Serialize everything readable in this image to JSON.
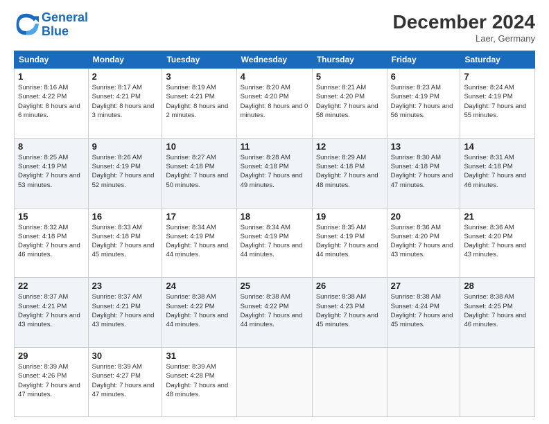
{
  "header": {
    "logo_line1": "General",
    "logo_line2": "Blue",
    "month_year": "December 2024",
    "location": "Laer, Germany"
  },
  "columns": [
    "Sunday",
    "Monday",
    "Tuesday",
    "Wednesday",
    "Thursday",
    "Friday",
    "Saturday"
  ],
  "weeks": [
    [
      {
        "day": "1",
        "sunrise": "8:16 AM",
        "sunset": "4:22 PM",
        "daylight": "8 hours and 6 minutes."
      },
      {
        "day": "2",
        "sunrise": "8:17 AM",
        "sunset": "4:21 PM",
        "daylight": "8 hours and 3 minutes."
      },
      {
        "day": "3",
        "sunrise": "8:19 AM",
        "sunset": "4:21 PM",
        "daylight": "8 hours and 2 minutes."
      },
      {
        "day": "4",
        "sunrise": "8:20 AM",
        "sunset": "4:20 PM",
        "daylight": "8 hours and 0 minutes."
      },
      {
        "day": "5",
        "sunrise": "8:21 AM",
        "sunset": "4:20 PM",
        "daylight": "7 hours and 58 minutes."
      },
      {
        "day": "6",
        "sunrise": "8:23 AM",
        "sunset": "4:19 PM",
        "daylight": "7 hours and 56 minutes."
      },
      {
        "day": "7",
        "sunrise": "8:24 AM",
        "sunset": "4:19 PM",
        "daylight": "7 hours and 55 minutes."
      }
    ],
    [
      {
        "day": "8",
        "sunrise": "8:25 AM",
        "sunset": "4:19 PM",
        "daylight": "7 hours and 53 minutes."
      },
      {
        "day": "9",
        "sunrise": "8:26 AM",
        "sunset": "4:19 PM",
        "daylight": "7 hours and 52 minutes."
      },
      {
        "day": "10",
        "sunrise": "8:27 AM",
        "sunset": "4:18 PM",
        "daylight": "7 hours and 50 minutes."
      },
      {
        "day": "11",
        "sunrise": "8:28 AM",
        "sunset": "4:18 PM",
        "daylight": "7 hours and 49 minutes."
      },
      {
        "day": "12",
        "sunrise": "8:29 AM",
        "sunset": "4:18 PM",
        "daylight": "7 hours and 48 minutes."
      },
      {
        "day": "13",
        "sunrise": "8:30 AM",
        "sunset": "4:18 PM",
        "daylight": "7 hours and 47 minutes."
      },
      {
        "day": "14",
        "sunrise": "8:31 AM",
        "sunset": "4:18 PM",
        "daylight": "7 hours and 46 minutes."
      }
    ],
    [
      {
        "day": "15",
        "sunrise": "8:32 AM",
        "sunset": "4:18 PM",
        "daylight": "7 hours and 46 minutes."
      },
      {
        "day": "16",
        "sunrise": "8:33 AM",
        "sunset": "4:18 PM",
        "daylight": "7 hours and 45 minutes."
      },
      {
        "day": "17",
        "sunrise": "8:34 AM",
        "sunset": "4:19 PM",
        "daylight": "7 hours and 44 minutes."
      },
      {
        "day": "18",
        "sunrise": "8:34 AM",
        "sunset": "4:19 PM",
        "daylight": "7 hours and 44 minutes."
      },
      {
        "day": "19",
        "sunrise": "8:35 AM",
        "sunset": "4:19 PM",
        "daylight": "7 hours and 44 minutes."
      },
      {
        "day": "20",
        "sunrise": "8:36 AM",
        "sunset": "4:20 PM",
        "daylight": "7 hours and 43 minutes."
      },
      {
        "day": "21",
        "sunrise": "8:36 AM",
        "sunset": "4:20 PM",
        "daylight": "7 hours and 43 minutes."
      }
    ],
    [
      {
        "day": "22",
        "sunrise": "8:37 AM",
        "sunset": "4:21 PM",
        "daylight": "7 hours and 43 minutes."
      },
      {
        "day": "23",
        "sunrise": "8:37 AM",
        "sunset": "4:21 PM",
        "daylight": "7 hours and 43 minutes."
      },
      {
        "day": "24",
        "sunrise": "8:38 AM",
        "sunset": "4:22 PM",
        "daylight": "7 hours and 44 minutes."
      },
      {
        "day": "25",
        "sunrise": "8:38 AM",
        "sunset": "4:22 PM",
        "daylight": "7 hours and 44 minutes."
      },
      {
        "day": "26",
        "sunrise": "8:38 AM",
        "sunset": "4:23 PM",
        "daylight": "7 hours and 45 minutes."
      },
      {
        "day": "27",
        "sunrise": "8:38 AM",
        "sunset": "4:24 PM",
        "daylight": "7 hours and 45 minutes."
      },
      {
        "day": "28",
        "sunrise": "8:38 AM",
        "sunset": "4:25 PM",
        "daylight": "7 hours and 46 minutes."
      }
    ],
    [
      {
        "day": "29",
        "sunrise": "8:39 AM",
        "sunset": "4:26 PM",
        "daylight": "7 hours and 47 minutes."
      },
      {
        "day": "30",
        "sunrise": "8:39 AM",
        "sunset": "4:27 PM",
        "daylight": "7 hours and 47 minutes."
      },
      {
        "day": "31",
        "sunrise": "8:39 AM",
        "sunset": "4:28 PM",
        "daylight": "7 hours and 48 minutes."
      },
      null,
      null,
      null,
      null
    ]
  ]
}
